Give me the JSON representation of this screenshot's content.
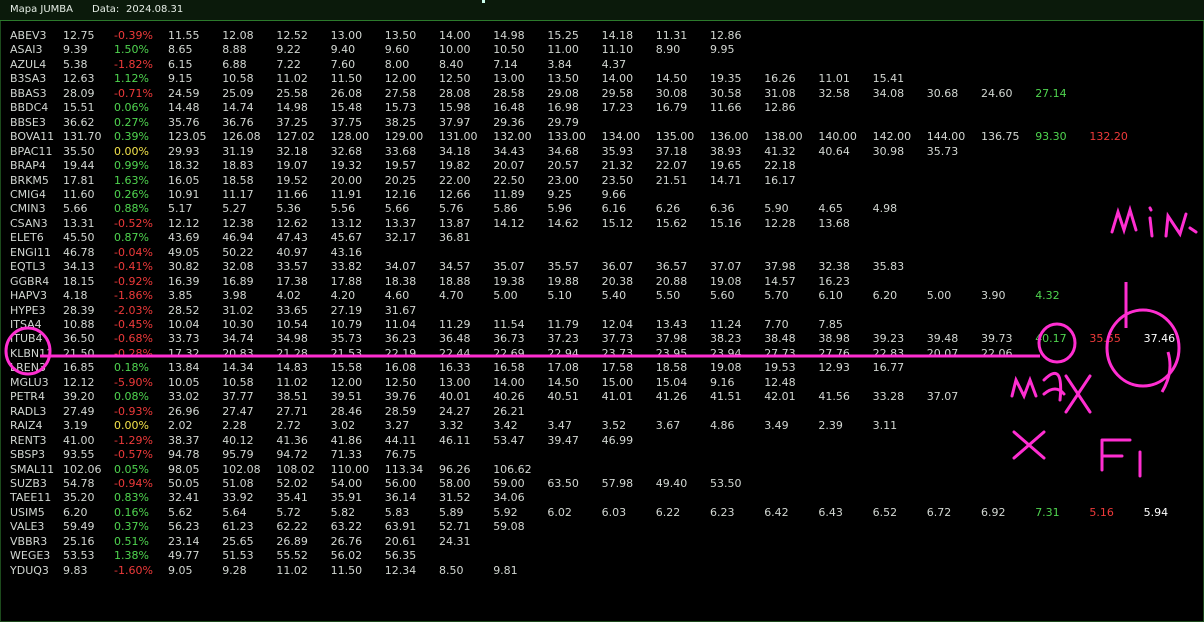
{
  "window": {
    "title": "Mapa JUMBA",
    "date_label": "Data:",
    "date_value": "2024.08.31"
  },
  "colors": {
    "background": "#000000",
    "text": "#d2d7d2",
    "positive": "#4fd44f",
    "negative": "#ee3a3a",
    "zero": "#f2e24a",
    "annotation": "#ff2ed1"
  },
  "rows": [
    {
      "ticker": "ABEV3",
      "price": "12.75",
      "change": "-0.39%",
      "levels": [
        "11.55",
        "12.08",
        "12.52",
        "13.00",
        "13.50",
        "14.00",
        "14.98",
        "15.25",
        "14.18",
        "11.31",
        "12.86"
      ]
    },
    {
      "ticker": "ASAI3",
      "price": "9.39",
      "change": "1.50%",
      "levels": [
        "8.65",
        "8.88",
        "9.22",
        "9.40",
        "9.60",
        "10.00",
        "10.50",
        "11.00",
        "11.10",
        "8.90",
        "9.95"
      ]
    },
    {
      "ticker": "AZUL4",
      "price": "5.38",
      "change": "-1.82%",
      "levels": [
        "6.15",
        "6.88",
        "7.22",
        "7.60",
        "8.00",
        "8.40",
        "7.14",
        "3.84",
        "4.37"
      ]
    },
    {
      "ticker": "B3SA3",
      "price": "12.63",
      "change": "1.12%",
      "levels": [
        "9.15",
        "10.58",
        "11.02",
        "11.50",
        "12.00",
        "12.50",
        "13.00",
        "13.50",
        "14.00",
        "14.50",
        "19.35",
        "16.26",
        "11.01",
        "15.41"
      ]
    },
    {
      "ticker": "BBAS3",
      "price": "28.09",
      "change": "-0.71%",
      "levels": [
        "24.59",
        "25.09",
        "25.58",
        "26.08",
        "27.58",
        "28.08",
        "28.58",
        "29.08",
        "29.58",
        "30.08",
        "30.58",
        "31.08",
        "32.58",
        "34.08",
        "30.68",
        "24.60",
        "27.14"
      ]
    },
    {
      "ticker": "BBDC4",
      "price": "15.51",
      "change": "0.06%",
      "levels": [
        "14.48",
        "14.74",
        "14.98",
        "15.48",
        "15.73",
        "15.98",
        "16.48",
        "16.98",
        "17.23",
        "16.79",
        "11.66",
        "12.86"
      ]
    },
    {
      "ticker": "BBSE3",
      "price": "36.62",
      "change": "0.27%",
      "levels": [
        "35.76",
        "36.76",
        "37.25",
        "37.75",
        "38.25",
        "37.97",
        "29.36",
        "29.79"
      ]
    },
    {
      "ticker": "BOVA11",
      "price": "131.70",
      "change": "0.39%",
      "levels": [
        "123.05",
        "126.08",
        "127.02",
        "128.00",
        "129.00",
        "131.00",
        "132.00",
        "133.00",
        "134.00",
        "135.00",
        "136.00",
        "138.00",
        "140.00",
        "142.00",
        "144.00",
        "136.75",
        "93.30",
        "132.20"
      ]
    },
    {
      "ticker": "BPAC11",
      "price": "35.50",
      "change": "0.00%",
      "levels": [
        "29.93",
        "31.19",
        "32.18",
        "32.68",
        "33.68",
        "34.18",
        "34.43",
        "34.68",
        "35.93",
        "37.18",
        "38.93",
        "41.32",
        "40.64",
        "30.98",
        "35.73"
      ]
    },
    {
      "ticker": "BRAP4",
      "price": "19.44",
      "change": "0.99%",
      "levels": [
        "18.32",
        "18.83",
        "19.07",
        "19.32",
        "19.57",
        "19.82",
        "20.07",
        "20.57",
        "21.32",
        "22.07",
        "19.65",
        "22.18"
      ]
    },
    {
      "ticker": "BRKM5",
      "price": "17.81",
      "change": "1.63%",
      "levels": [
        "16.05",
        "18.58",
        "19.52",
        "20.00",
        "20.25",
        "22.00",
        "22.50",
        "23.00",
        "23.50",
        "21.51",
        "14.71",
        "16.17"
      ]
    },
    {
      "ticker": "CMIG4",
      "price": "11.60",
      "change": "0.26%",
      "levels": [
        "10.91",
        "11.17",
        "11.66",
        "11.91",
        "12.16",
        "12.66",
        "11.89",
        "9.25",
        "9.66"
      ]
    },
    {
      "ticker": "CMIN3",
      "price": "5.66",
      "change": "0.88%",
      "levels": [
        "5.17",
        "5.27",
        "5.36",
        "5.56",
        "5.66",
        "5.76",
        "5.86",
        "5.96",
        "6.16",
        "6.26",
        "6.36",
        "5.90",
        "4.65",
        "4.98"
      ]
    },
    {
      "ticker": "CSAN3",
      "price": "13.31",
      "change": "-0.52%",
      "levels": [
        "12.12",
        "12.38",
        "12.62",
        "13.12",
        "13.37",
        "13.87",
        "14.12",
        "14.62",
        "15.12",
        "15.62",
        "15.16",
        "12.28",
        "13.68"
      ]
    },
    {
      "ticker": "ELET6",
      "price": "45.50",
      "change": "0.87%",
      "levels": [
        "43.69",
        "46.94",
        "47.43",
        "45.67",
        "32.17",
        "36.81"
      ]
    },
    {
      "ticker": "ENGI11",
      "price": "46.78",
      "change": "-0.04%",
      "levels": [
        "49.05",
        "50.22",
        "40.97",
        "43.16"
      ]
    },
    {
      "ticker": "EQTL3",
      "price": "34.13",
      "change": "-0.41%",
      "levels": [
        "30.82",
        "32.08",
        "33.57",
        "33.82",
        "34.07",
        "34.57",
        "35.07",
        "35.57",
        "36.07",
        "36.57",
        "37.07",
        "37.98",
        "32.38",
        "35.83"
      ]
    },
    {
      "ticker": "GGBR4",
      "price": "18.15",
      "change": "-0.92%",
      "levels": [
        "16.39",
        "16.89",
        "17.38",
        "17.88",
        "18.38",
        "18.88",
        "19.38",
        "19.88",
        "20.38",
        "20.88",
        "19.08",
        "14.57",
        "16.23"
      ]
    },
    {
      "ticker": "HAPV3",
      "price": "4.18",
      "change": "-1.86%",
      "levels": [
        "3.85",
        "3.98",
        "4.02",
        "4.20",
        "4.60",
        "4.70",
        "5.00",
        "5.10",
        "5.40",
        "5.50",
        "5.60",
        "5.70",
        "6.10",
        "6.20",
        "5.00",
        "3.90",
        "4.32"
      ]
    },
    {
      "ticker": "HYPE3",
      "price": "28.39",
      "change": "-2.03%",
      "levels": [
        "28.52",
        "31.02",
        "33.65",
        "27.19",
        "31.67"
      ]
    },
    {
      "ticker": "ITSA4",
      "price": "10.88",
      "change": "-0.45%",
      "levels": [
        "10.04",
        "10.30",
        "10.54",
        "10.79",
        "11.04",
        "11.29",
        "11.54",
        "11.79",
        "12.04",
        "13.43",
        "11.24",
        "7.70",
        "7.85"
      ]
    },
    {
      "ticker": "ITUB4",
      "price": "36.50",
      "change": "-0.68%",
      "levels": [
        "33.73",
        "34.74",
        "34.98",
        "35.73",
        "36.23",
        "36.48",
        "36.73",
        "37.23",
        "37.73",
        "37.98",
        "38.23",
        "38.48",
        "38.98",
        "39.23",
        "39.48",
        "39.73",
        "40.17",
        "35.55",
        "37.46"
      ]
    },
    {
      "ticker": "KLBN11",
      "price": "21.50",
      "change": "-0.28%",
      "levels": [
        "17.32",
        "20.83",
        "21.28",
        "21.53",
        "22.19",
        "22.44",
        "22.69",
        "22.94",
        "23.73",
        "23.95",
        "23.94",
        "27.73",
        "27.76",
        "22.83",
        "20.07",
        "22.06"
      ]
    },
    {
      "ticker": "LREN3",
      "price": "16.85",
      "change": "0.18%",
      "levels": [
        "13.84",
        "14.34",
        "14.83",
        "15.58",
        "16.08",
        "16.33",
        "16.58",
        "17.08",
        "17.58",
        "18.58",
        "19.08",
        "19.53",
        "12.93",
        "16.77"
      ]
    },
    {
      "ticker": "MGLU3",
      "price": "12.12",
      "change": "-5.90%",
      "levels": [
        "10.05",
        "10.58",
        "11.02",
        "12.00",
        "12.50",
        "13.00",
        "14.00",
        "14.50",
        "15.00",
        "15.04",
        "9.16",
        "12.48"
      ]
    },
    {
      "ticker": "PETR4",
      "price": "39.20",
      "change": "0.08%",
      "levels": [
        "33.02",
        "37.77",
        "38.51",
        "39.51",
        "39.76",
        "40.01",
        "40.26",
        "40.51",
        "41.01",
        "41.26",
        "41.51",
        "42.01",
        "41.56",
        "33.28",
        "37.07"
      ]
    },
    {
      "ticker": "RADL3",
      "price": "27.49",
      "change": "-0.93%",
      "levels": [
        "26.96",
        "27.47",
        "27.71",
        "28.46",
        "28.59",
        "24.27",
        "26.21"
      ]
    },
    {
      "ticker": "RAIZ4",
      "price": "3.19",
      "change": "0.00%",
      "levels": [
        "2.02",
        "2.28",
        "2.72",
        "3.02",
        "3.27",
        "3.32",
        "3.42",
        "3.47",
        "3.52",
        "3.67",
        "4.86",
        "3.49",
        "2.39",
        "3.11"
      ]
    },
    {
      "ticker": "RENT3",
      "price": "41.00",
      "change": "-1.29%",
      "levels": [
        "38.37",
        "40.12",
        "41.36",
        "41.86",
        "44.11",
        "46.11",
        "53.47",
        "39.47",
        "46.99"
      ]
    },
    {
      "ticker": "SBSP3",
      "price": "93.55",
      "change": "-0.57%",
      "levels": [
        "94.78",
        "95.79",
        "94.72",
        "71.33",
        "76.75"
      ]
    },
    {
      "ticker": "SMAL11",
      "price": "102.06",
      "change": "0.05%",
      "levels": [
        "98.05",
        "102.08",
        "108.02",
        "110.00",
        "113.34",
        "96.26",
        "106.62"
      ]
    },
    {
      "ticker": "SUZB3",
      "price": "54.78",
      "change": "-0.94%",
      "levels": [
        "50.05",
        "51.08",
        "52.02",
        "54.00",
        "56.00",
        "58.00",
        "59.00",
        "63.50",
        "57.98",
        "49.40",
        "53.50"
      ]
    },
    {
      "ticker": "TAEE11",
      "price": "35.20",
      "change": "0.83%",
      "levels": [
        "32.41",
        "33.92",
        "35.41",
        "35.91",
        "36.14",
        "31.52",
        "34.06"
      ]
    },
    {
      "ticker": "USIM5",
      "price": "6.20",
      "change": "0.16%",
      "levels": [
        "5.62",
        "5.64",
        "5.72",
        "5.82",
        "5.83",
        "5.89",
        "5.92",
        "6.02",
        "6.03",
        "6.22",
        "6.23",
        "6.42",
        "6.43",
        "6.52",
        "6.72",
        "6.92",
        "7.31",
        "5.16",
        "5.94"
      ]
    },
    {
      "ticker": "VALE3",
      "price": "59.49",
      "change": "0.37%",
      "levels": [
        "56.23",
        "61.23",
        "62.22",
        "63.22",
        "63.91",
        "52.71",
        "59.08"
      ]
    },
    {
      "ticker": "VBBR3",
      "price": "25.16",
      "change": "0.51%",
      "levels": [
        "23.14",
        "25.65",
        "26.89",
        "26.76",
        "20.61",
        "24.31"
      ]
    },
    {
      "ticker": "WEGE3",
      "price": "53.53",
      "change": "1.38%",
      "levels": [
        "49.77",
        "51.53",
        "55.52",
        "56.02",
        "56.35"
      ]
    },
    {
      "ticker": "YDUQ3",
      "price": "9.83",
      "change": "-1.60%",
      "levels": [
        "9.05",
        "9.28",
        "11.02",
        "11.50",
        "12.34",
        "8.50",
        "9.81"
      ]
    }
  ],
  "special_colors": {
    "BBAS3": {
      "16": "pos"
    },
    "BOVA11": {
      "16": "pos",
      "17": "neg"
    },
    "HAPV3": {
      "16": "pos"
    },
    "ITUB4": {
      "16": "pos",
      "17": "neg",
      "18": "white"
    },
    "USIM5": {
      "16": "pos",
      "17": "neg",
      "18": "white"
    }
  },
  "handwriting": {
    "text_min": "min",
    "text_max": "max",
    "text_f1": "F1"
  }
}
